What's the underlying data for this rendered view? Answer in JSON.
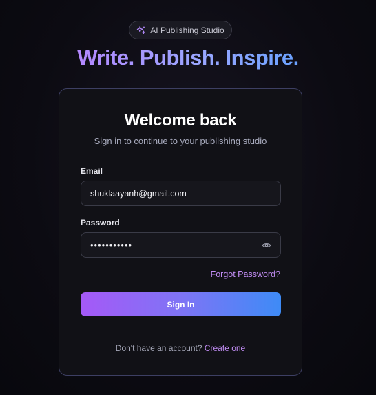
{
  "badge": {
    "icon": "sparkles-icon",
    "label": "AI Publishing Studio"
  },
  "headline": "Write. Publish. Inspire.",
  "card": {
    "title": "Welcome back",
    "subtitle": "Sign in to continue to your publishing studio",
    "email": {
      "label": "Email",
      "value": "shuklaayanh@gmail.com"
    },
    "password": {
      "label": "Password",
      "value": "•••••••••••",
      "toggle_icon": "eye-icon"
    },
    "forgot_label": "Forgot Password?",
    "signin_label": "Sign In",
    "footer": {
      "prompt": "Don't have an account?",
      "link": "Create one"
    }
  },
  "colors": {
    "accent_purple": "#a559f7",
    "accent_blue": "#3e8bf6",
    "link": "#c08cf2",
    "card_border": "#3d3f63"
  }
}
